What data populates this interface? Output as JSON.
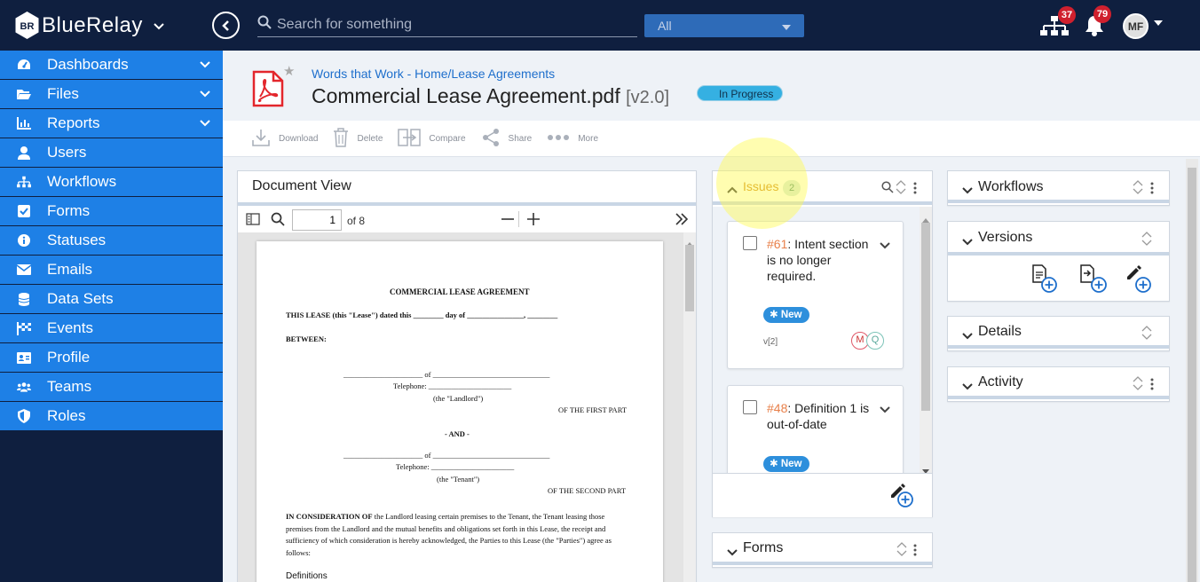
{
  "app": {
    "name": "BlueRelay",
    "logo_mark": "BR"
  },
  "search": {
    "placeholder": "Search for something",
    "scope": "All"
  },
  "notifications": {
    "org_count": "37",
    "bell_count": "79"
  },
  "user": {
    "initials": "MF"
  },
  "sidebar": {
    "items": [
      {
        "label": "Dashboards",
        "icon": "dashboard-icon",
        "expandable": true
      },
      {
        "label": "Files",
        "icon": "folder-icon",
        "expandable": true
      },
      {
        "label": "Reports",
        "icon": "chart-icon",
        "expandable": true
      },
      {
        "label": "Users",
        "icon": "user-icon",
        "expandable": false
      },
      {
        "label": "Workflows",
        "icon": "sitemap-icon",
        "expandable": false
      },
      {
        "label": "Forms",
        "icon": "checkbox-icon",
        "expandable": false
      },
      {
        "label": "Statuses",
        "icon": "info-icon",
        "expandable": false
      },
      {
        "label": "Emails",
        "icon": "envelope-icon",
        "expandable": false
      },
      {
        "label": "Data Sets",
        "icon": "database-icon",
        "expandable": false
      },
      {
        "label": "Events",
        "icon": "flag-icon",
        "expandable": false
      },
      {
        "label": "Profile",
        "icon": "id-card-icon",
        "expandable": false
      },
      {
        "label": "Teams",
        "icon": "users-icon",
        "expandable": false
      },
      {
        "label": "Roles",
        "icon": "shield-icon",
        "expandable": false
      }
    ]
  },
  "document": {
    "breadcrumb": "Words that Work - Home/Lease Agreements",
    "title": "Commercial Lease Agreement.pdf",
    "version": "[v2.0]",
    "status": "In Progress"
  },
  "toolbar": {
    "download": "Download",
    "delete": "Delete",
    "compare": "Compare",
    "share": "Share",
    "more": "More"
  },
  "document_view": {
    "title": "Document View",
    "page": "1",
    "of_pages": "of 8",
    "content": {
      "heading": "COMMERCIAL LEASE AGREEMENT",
      "line1": "THIS LEASE (this \"Lease\") dated this ________ day of _______________, ________",
      "between": "BETWEEN:",
      "landlord_line": "_____________________ of _______________________________",
      "telephone1": "Telephone: ______________________",
      "landlord": "(the \"Landlord\")",
      "first_part": "OF THE FIRST PART",
      "and": "- AND -",
      "tenant_line": "_____________________ of _______________________________",
      "telephone2": "Telephone: ______________________",
      "tenant": "(the \"Tenant\")",
      "second_part": "OF THE SECOND PART",
      "consid_bold": "IN CONSIDERATION OF",
      "consid1": "the Landlord leasing certain premises to the Tenant, the Tenant leasing those",
      "consid2": "premises from the Landlord and the mutual benefits and obligations set forth in this Lease, the receipt and",
      "consid3": "sufficiency of which consideration is hereby acknowledged, the Parties to this Lease (the \"Parties\") agree as",
      "consid4": "follows:",
      "definitions": "Definitions"
    }
  },
  "issues": {
    "title": "Issues",
    "count": "2",
    "items": [
      {
        "number": "#61",
        "text": ": Intent section is no longer required.",
        "badge": "New",
        "version": "v[2]",
        "avatars": [
          "M",
          "Q"
        ]
      },
      {
        "number": "#48",
        "text": ": Definition 1 is out-of-date",
        "badge": "New"
      }
    ]
  },
  "forms_panel": {
    "title": "Forms"
  },
  "right_panels": {
    "workflows": "Workflows",
    "versions": "Versions",
    "details": "Details",
    "activity": "Activity"
  },
  "colors": {
    "topbar": "#0f1f3f",
    "sidebar_item": "#1e80e6",
    "issue_number": "#e8804a",
    "status_badge": "#35b0e2",
    "notification_badge": "#d0202e"
  }
}
